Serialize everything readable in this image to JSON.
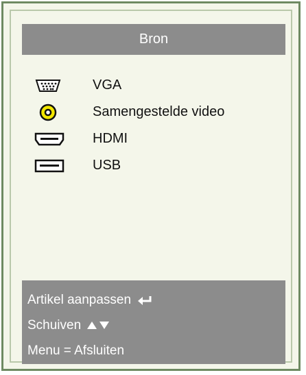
{
  "menu": {
    "title": "Bron"
  },
  "sources": [
    {
      "label": "VGA",
      "icon": "vga-icon"
    },
    {
      "label": "Samengestelde video",
      "icon": "composite-video-icon"
    },
    {
      "label": "HDMI",
      "icon": "hdmi-icon"
    },
    {
      "label": "USB",
      "icon": "usb-icon"
    }
  ],
  "footer": {
    "adjust_label": "Artikel aanpassen",
    "adjust_icon": "enter-icon",
    "scroll_label": "Schuiven",
    "scroll_icons": [
      "up-arrow-icon",
      "down-arrow-icon"
    ],
    "exit_label": "Menu = Afsluiten"
  },
  "colors": {
    "title_bar": "#8c8c8c",
    "footer_bar": "#8c8c8c",
    "panel_background": "#f4f6ea",
    "outer_border": "#6e8a62",
    "composite_icon": "#f2e600"
  }
}
